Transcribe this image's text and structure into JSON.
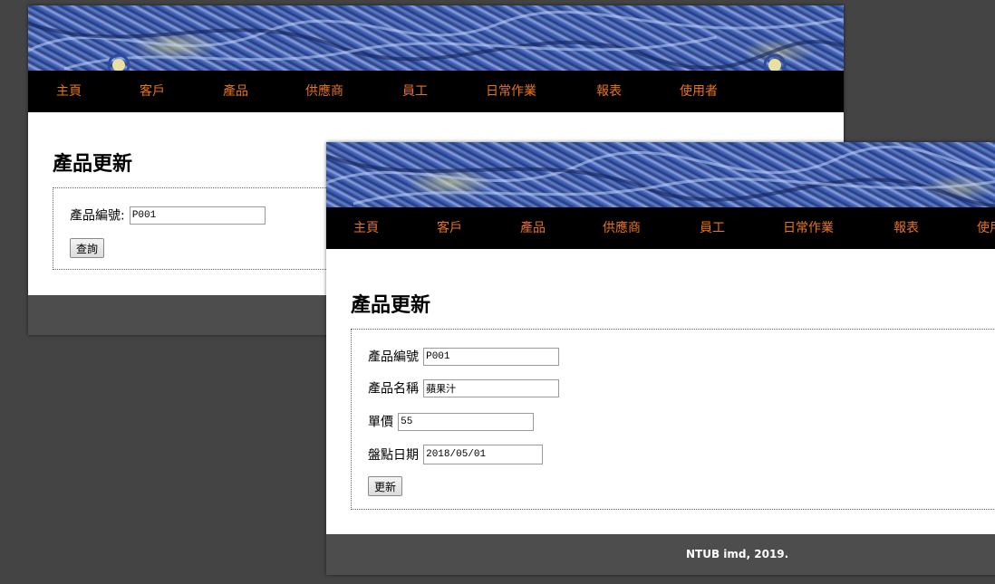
{
  "nav_items": [
    "主頁",
    "客戶",
    "產品",
    "供應商",
    "員工",
    "日常作業",
    "報表",
    "使用者"
  ],
  "back_window": {
    "title": "產品更新",
    "product_id_label": "產品編號:",
    "product_id_value": "P001",
    "query_button": "查詢"
  },
  "front_window": {
    "title": "產品更新",
    "product_id_label": "產品編號",
    "product_id_value": "P001",
    "product_name_label": "產品名稱",
    "product_name_value": "蘋果汁",
    "price_label": "單價",
    "price_value": "55",
    "inventory_date_label": "盤點日期",
    "inventory_date_value": "2018/05/01",
    "update_button": "更新",
    "footer_text": "NTUB imd, 2019."
  },
  "colors": {
    "background": "#444444",
    "nav_bg": "#000000",
    "nav_text": "#e8741c",
    "footer_bg": "#4d4d4d"
  }
}
